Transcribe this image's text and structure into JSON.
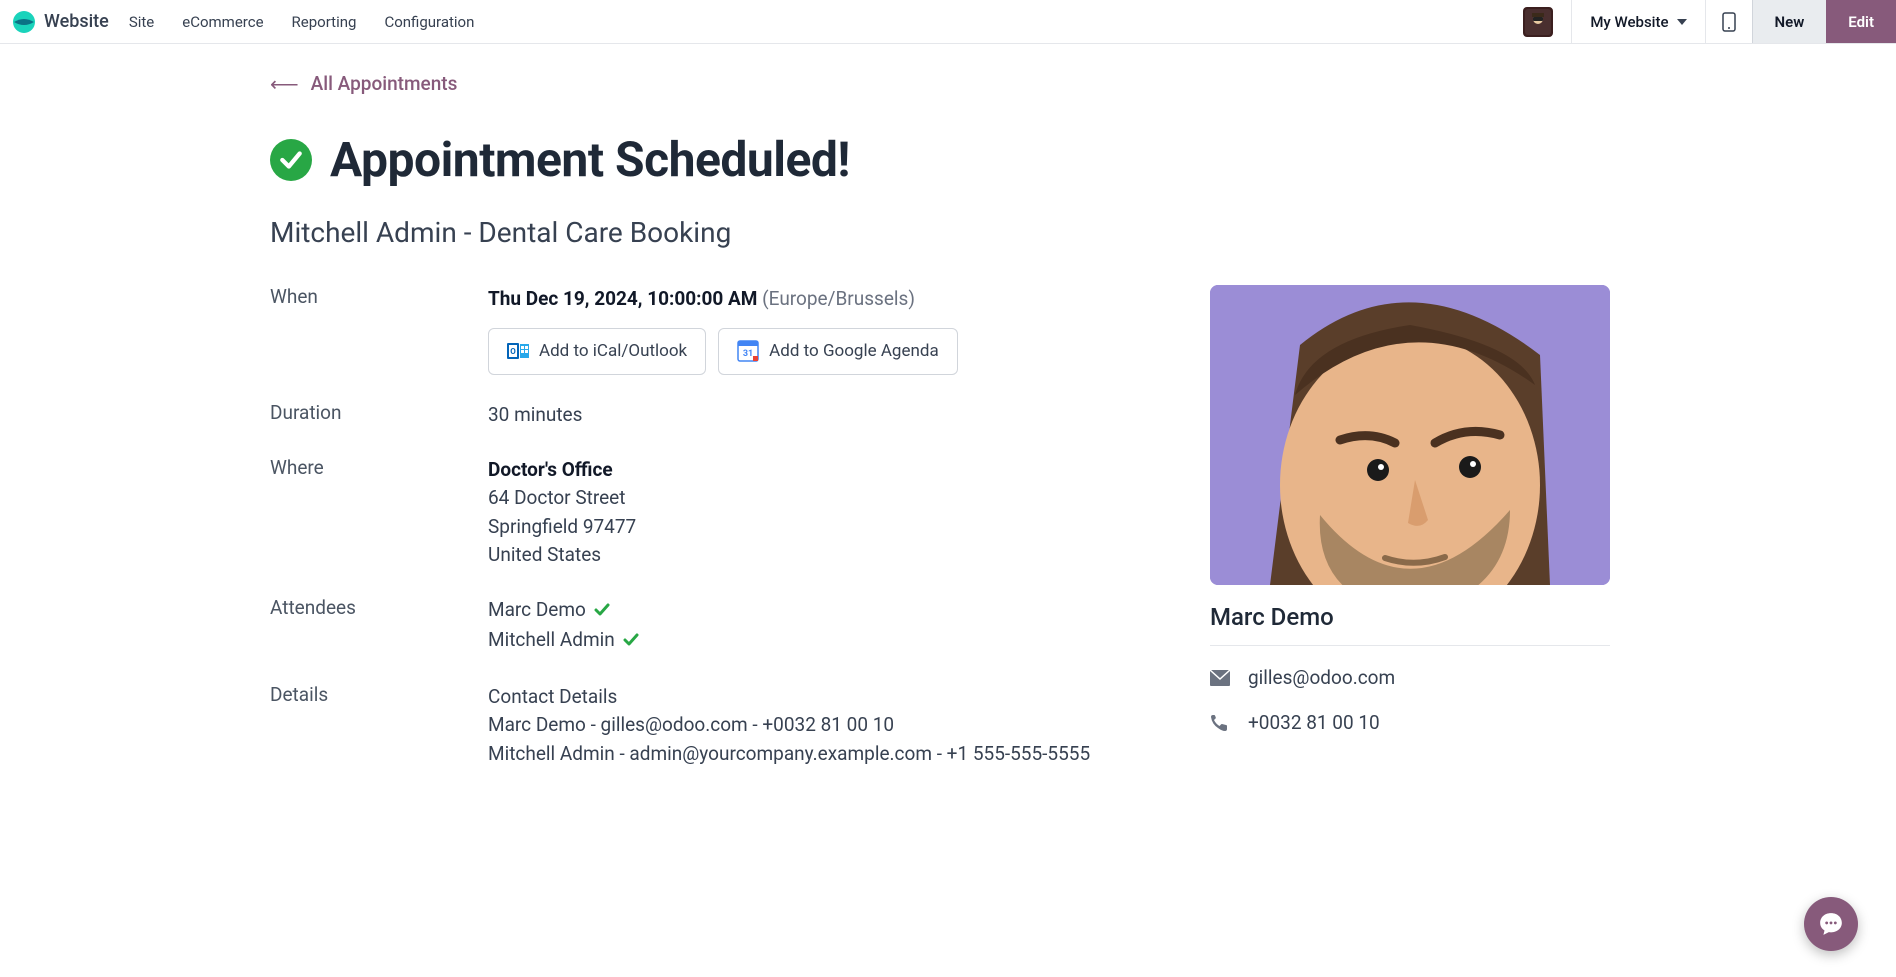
{
  "navbar": {
    "brand": "Website",
    "menu": [
      "Site",
      "eCommerce",
      "Reporting",
      "Configuration"
    ],
    "website_select": "My Website",
    "new_label": "New",
    "edit_label": "Edit"
  },
  "back_link": "All Appointments",
  "page": {
    "title": "Appointment Scheduled!",
    "subtitle": "Mitchell Admin - Dental Care Booking"
  },
  "labels": {
    "when": "When",
    "duration": "Duration",
    "where": "Where",
    "attendees": "Attendees",
    "details": "Details"
  },
  "when": {
    "datetime": "Thu Dec 19, 2024, 10:00:00 AM",
    "tz": "(Europe/Brussels)",
    "ical_label": "Add to iCal/Outlook",
    "google_label": "Add to Google Agenda"
  },
  "duration": "30 minutes",
  "where": {
    "name": "Doctor's Office",
    "street": "64 Doctor Street",
    "city_zip": "Springfield 97477",
    "country": "United States"
  },
  "attendees": [
    {
      "name": "Marc Demo",
      "confirmed": true
    },
    {
      "name": "Mitchell Admin",
      "confirmed": true
    }
  ],
  "details": {
    "heading": "Contact Details",
    "lines": [
      "Marc Demo - gilles@odoo.com - +0032 81 00 10",
      "Mitchell Admin - admin@yourcompany.example.com - +1 555-555-5555"
    ]
  },
  "contact_card": {
    "name": "Marc Demo",
    "email": "gilles@odoo.com",
    "phone": "+0032 81 00 10"
  }
}
